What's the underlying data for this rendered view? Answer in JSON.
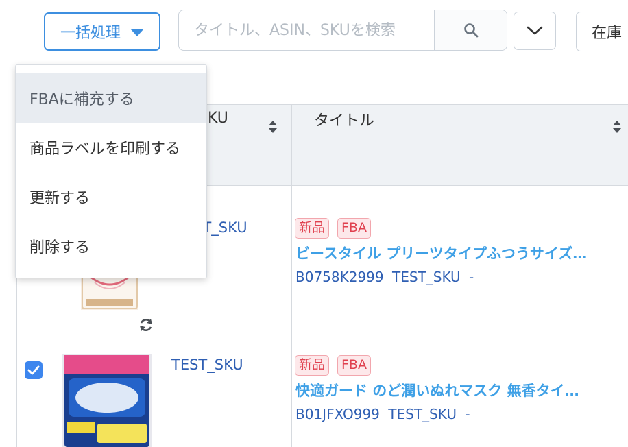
{
  "toolbar": {
    "bulk_action_label": "一括処理",
    "search_placeholder": "タイトル、ASIN、SKUを検索",
    "stock_label": "在庫"
  },
  "menu": {
    "items": [
      {
        "label": "FBAに補充する"
      },
      {
        "label": "商品ラベルを印刷する"
      },
      {
        "label": "更新する"
      },
      {
        "label": "削除する"
      }
    ]
  },
  "table": {
    "columns": {
      "sku": "SKU",
      "title": "タイトル"
    },
    "rows": [
      {
        "sku": "TEST_SKU",
        "badges": [
          "新品",
          "FBA"
        ],
        "title": "ビースタイル プリーツタイプふつうサイズ…",
        "asin": "B0758K2999",
        "sku_meta": "TEST_SKU",
        "extra": "-"
      },
      {
        "sku": "TEST_SKU",
        "badges": [
          "新品",
          "FBA"
        ],
        "title": "快適ガード のど潤いぬれマスク 無香タイ…",
        "asin": "B01JFXO999",
        "sku_meta": "TEST_SKU",
        "extra": "-"
      }
    ]
  },
  "colors": {
    "accent": "#3d8fe0",
    "badge_text": "#e0414f",
    "title_link": "#3ea0e6",
    "sku_text": "#2f5fb3"
  }
}
